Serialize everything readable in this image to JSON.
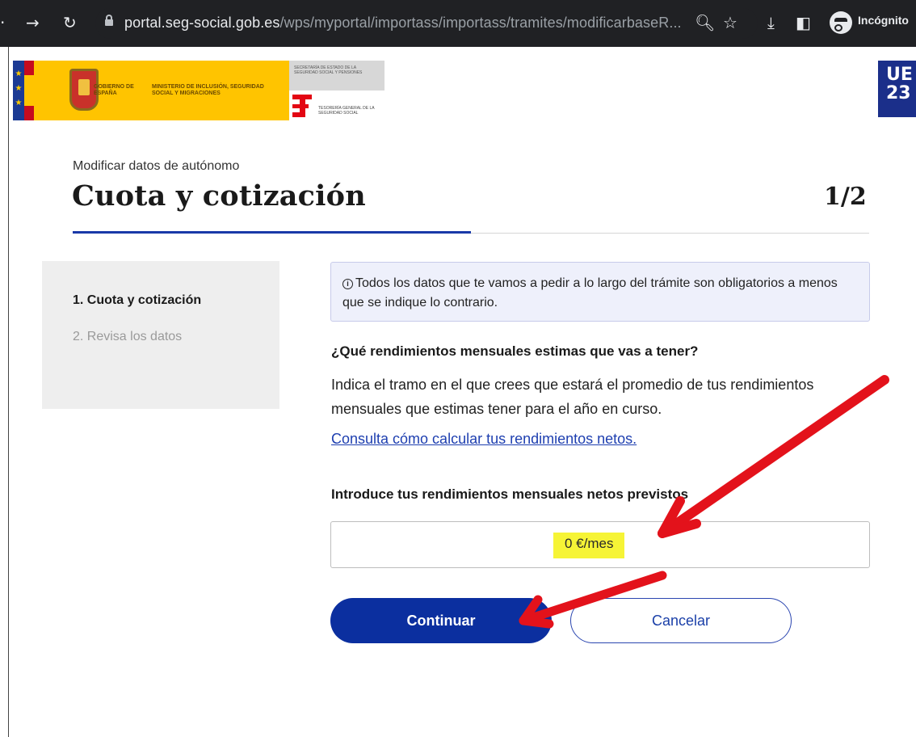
{
  "browser": {
    "url_domain": "portal.seg-social.gob.es",
    "url_path": "/wps/myportal/importass/importass/tramites/modificarbaseR...",
    "incognito_label": "Incógnito"
  },
  "header": {
    "gov_left": "GOBIERNO DE ESPAÑA",
    "ministry": "MINISTERIO DE INCLUSIÓN, SEGURIDAD SOCIAL Y MIGRACIONES",
    "secretaria": "SECRETARÍA DE ESTADO DE LA SEGURIDAD SOCIAL Y PENSIONES",
    "tgss": "TESORERÍA GENERAL DE LA SEGURIDAD SOCIAL",
    "eu_badge": "UE 23"
  },
  "page": {
    "subtitle": "Modificar datos de autónomo",
    "title": "Cuota y cotización",
    "step_counter": "1/2"
  },
  "steps": [
    {
      "label": "1. Cuota y cotización",
      "active": true
    },
    {
      "label": "2. Revisa los datos",
      "active": false
    }
  ],
  "info": {
    "text": "Todos los datos que te vamos a pedir a lo largo del trámite son obligatorios a menos que se indique lo contrario."
  },
  "question": {
    "title": "¿Qué rendimientos mensuales estimas que vas a tener?",
    "help": "Indica el tramo en el que crees que estará el promedio de tus rendimientos mensuales que estimas tener para el año en curso.",
    "link": "Consulta cómo calcular tus rendimientos netos."
  },
  "amount": {
    "label": "Introduce tus rendimientos mensuales netos previstos",
    "value": "0 €/mes"
  },
  "buttons": {
    "continue": "Continuar",
    "cancel": "Cancelar"
  },
  "colors": {
    "primary": "#0b2f9f",
    "link": "#1e3fb0",
    "highlight": "#f6f436",
    "annotation": "#e3121b"
  }
}
